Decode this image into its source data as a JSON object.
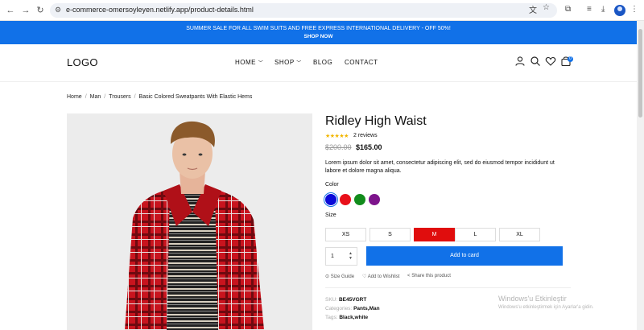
{
  "browser": {
    "url": "e-commerce-omersoyleyen.netlify.app/product-details.html"
  },
  "banner": {
    "line1": "SUMMER SALE FOR ALL SWIM SUITS AND FREE EXPRESS INTERNATIONAL DELIVERY - OFF 50%!",
    "line2": "SHOP NOW"
  },
  "header": {
    "logo": "LOGO",
    "menu": [
      "HOME",
      "SHOP",
      "BLOG",
      "CONTACT"
    ],
    "cart_count": "0"
  },
  "breadcrumb": [
    "Home",
    "Man",
    "Trousers",
    "Basic Colored Sweatpants With Elastic Hems"
  ],
  "product": {
    "title": "Ridley High Waist",
    "stars": "★★★★★",
    "reviews": "2 reviews",
    "old_price": "$200.00",
    "price": "$165.00",
    "description": "Lorem ipsum dolor sit amet, consectetur adipiscing elit, sed do eiusmod tempor incididunt ut labore et dolore magna aliqua.",
    "color_label": "Color",
    "colors": [
      "#0a0ad8",
      "#e8101a",
      "#128c1c",
      "#7d148c"
    ],
    "size_label": "Size",
    "sizes": [
      "XS",
      "S",
      "M",
      "L",
      "XL"
    ],
    "selected_size": "M",
    "quantity": "1",
    "add_to_cart": "Add to card",
    "actions": [
      "Size Guide",
      "Add to Wishlist",
      "Share this product"
    ],
    "sku_label": "SKU:",
    "sku": "BE45VGRT",
    "categories_label": "Categories:",
    "categories": "Pants,Man",
    "tags_label": "Tags:",
    "tags": "Black,white"
  },
  "watermark": {
    "title": "Windows'u Etkinleştir",
    "subtitle": "Windows'u etkinleştirmek için Ayarlar'a gidin."
  },
  "colors": {
    "accent": "#1171e8",
    "selected_size_bg": "#e00d0d",
    "star": "#f2b600"
  }
}
